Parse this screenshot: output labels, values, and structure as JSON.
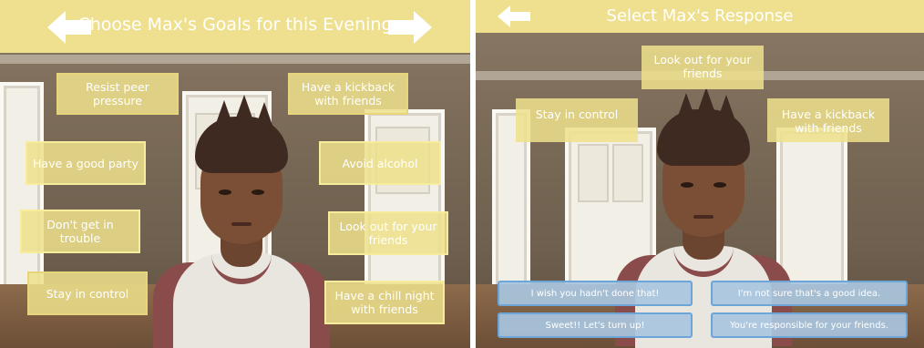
{
  "goals_screen": {
    "title": "Choose Max's Goals for this Evening",
    "back_icon": "arrow-left-icon",
    "next_icon": "arrow-right-icon",
    "goals": [
      "Resist peer pressure",
      "Have a kickback with friends",
      "Have a good party",
      "Avoid alcohol",
      "Don't get in trouble",
      "Look out for your friends",
      "Stay in control",
      "Have a chill night with friends"
    ]
  },
  "response_screen": {
    "title": "Select Max's Response",
    "back_icon": "arrow-left-icon",
    "selected_goals": [
      "Look out for your friends",
      "Stay in control",
      "Have a kickback with friends"
    ],
    "responses": [
      "I wish you hadn't done that!",
      "I'm not sure that's a good idea.",
      "Sweet!! Let's turn up!",
      "You're responsible for your friends."
    ]
  },
  "colors": {
    "title_bar": "#efe08f",
    "goal_card": "#ede18c",
    "response_button": "#a8c5de",
    "response_border": "#6ea5d8"
  }
}
